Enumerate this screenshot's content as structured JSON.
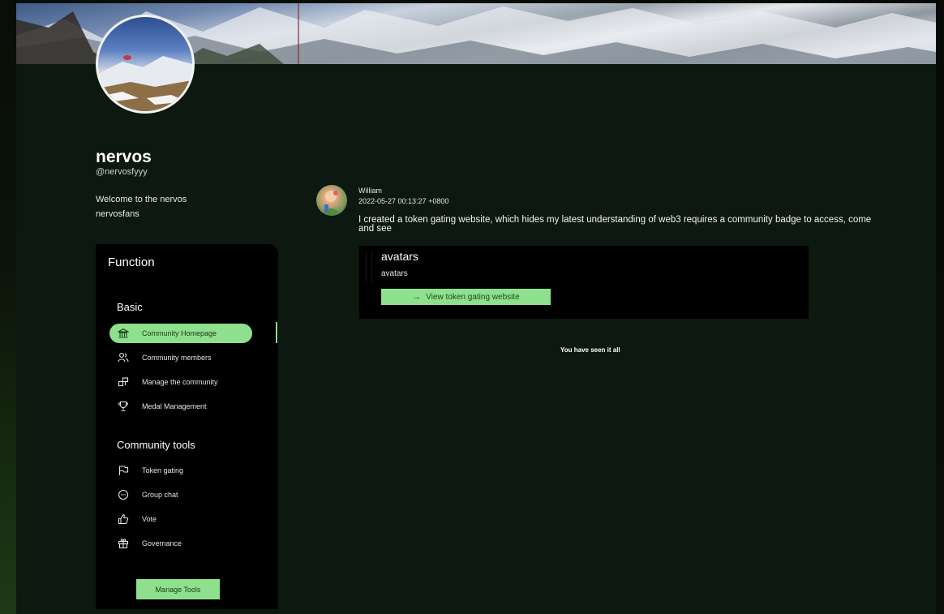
{
  "community": {
    "name": "nervos",
    "handle": "@nervosfyyy",
    "description_lines": [
      "Welcome to the nervos",
      "nervosfans"
    ]
  },
  "sidebar": {
    "title": "Function",
    "sections": [
      {
        "title": "Basic",
        "items": [
          {
            "label": "Community Homepage",
            "icon": "bank-icon",
            "active": true
          },
          {
            "label": "Community members",
            "icon": "members-icon",
            "active": false
          },
          {
            "label": "Manage the community",
            "icon": "manage-icon",
            "active": false
          },
          {
            "label": "Medal Management",
            "icon": "trophy-icon",
            "active": false
          }
        ]
      },
      {
        "title": "Community tools",
        "items": [
          {
            "label": "Token gating",
            "icon": "flag-icon",
            "active": false
          },
          {
            "label": "Group chat",
            "icon": "chat-icon",
            "active": false
          },
          {
            "label": "Vote",
            "icon": "thumbs-up-icon",
            "active": false
          },
          {
            "label": "Governance",
            "icon": "gift-icon",
            "active": false
          }
        ]
      }
    ],
    "manage_button": "Manage Tools"
  },
  "post": {
    "author": "William",
    "timestamp": "2022-05-27 00:13:27 +0800",
    "text": "I created a token gating website, which hides my latest understanding of web3 requires a community badge to access, come and see",
    "card": {
      "title": "avatars",
      "subtitle": "avatars",
      "button_label": "View token gating website"
    }
  },
  "feed_end": "You have seen it all",
  "colors": {
    "accent": "#8ee08c",
    "page_bg": "#0d1810",
    "panel_bg": "#000000"
  }
}
